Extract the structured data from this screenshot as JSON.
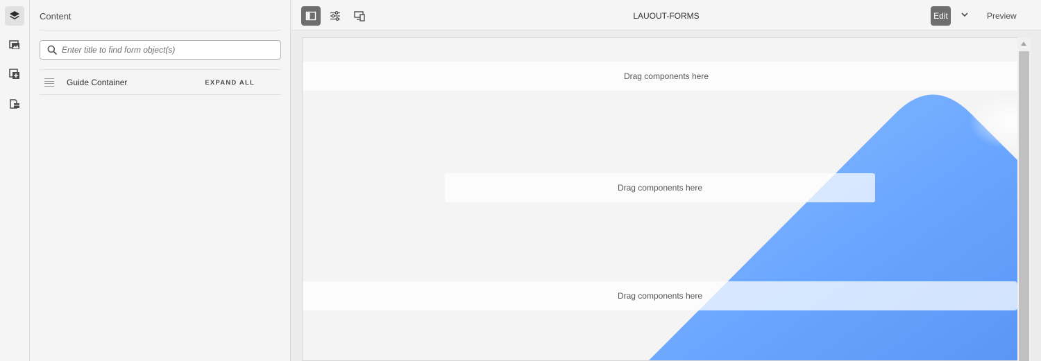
{
  "rail": {
    "items": [
      {
        "icon": "layers-icon",
        "active": true
      },
      {
        "icon": "assets-icon",
        "active": false
      },
      {
        "icon": "components-icon",
        "active": false
      },
      {
        "icon": "data-sources-icon",
        "active": false
      }
    ]
  },
  "panel": {
    "title": "Content",
    "search_placeholder": "Enter title to find form object(s)",
    "search_value": "",
    "tree": [
      {
        "label": "Guide Container",
        "action": "EXPAND ALL"
      }
    ]
  },
  "toolbar": {
    "buttons": [
      {
        "icon": "toggle-side-panel-icon",
        "active": true
      },
      {
        "icon": "properties-icon",
        "active": false
      },
      {
        "icon": "emulator-icon",
        "active": false
      }
    ],
    "page_title": "LAUOUT-FORMS",
    "edit_label": "Edit",
    "preview_label": "Preview"
  },
  "canvas": {
    "dropzones": [
      {
        "label": "Drag components here"
      },
      {
        "label": "Drag components here"
      },
      {
        "label": "Drag components here"
      }
    ],
    "colors": {
      "background": "#f4f4f4",
      "accent_blue": "#6aa6ff"
    }
  }
}
